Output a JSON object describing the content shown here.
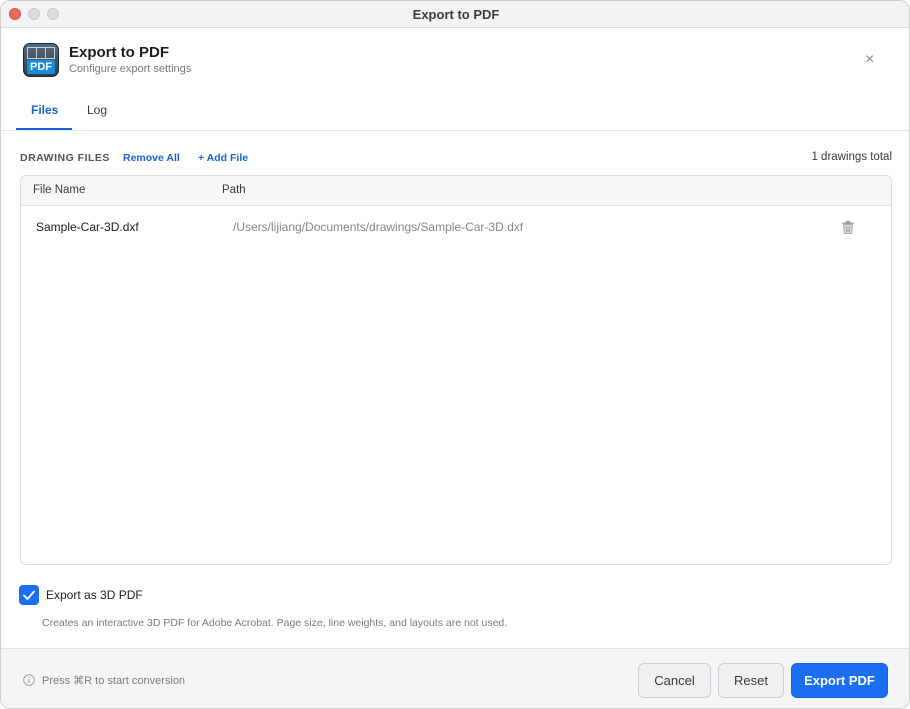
{
  "window": {
    "title": "Export to PDF"
  },
  "header": {
    "icon_label": "PDF",
    "title": "Export to PDF",
    "subtitle": "Configure export settings",
    "close_glyph": "×"
  },
  "tabs": [
    {
      "label": "Files",
      "active": true
    },
    {
      "label": "Log",
      "active": false
    }
  ],
  "files": {
    "section_label": "DRAWING FILES",
    "remove_all_label": "Remove All",
    "add_file_label": "+ Add File",
    "total_text": "1 drawings total",
    "columns": {
      "name": "File Name",
      "path": "Path"
    },
    "rows": [
      {
        "name": "Sample-Car-3D.dxf",
        "path": "/Users/lijiang/Documents/drawings/Sample-Car-3D.dxf"
      }
    ]
  },
  "options": {
    "export_3d_label": "Export as 3D PDF",
    "export_3d_checked": true,
    "export_3d_hint": "Creates an interactive 3D PDF for Adobe Acrobat. Page size, line weights, and layouts are not used."
  },
  "footer": {
    "hint": "Press ⌘R to start conversion",
    "cancel_label": "Cancel",
    "reset_label": "Reset",
    "export_label": "Export PDF"
  },
  "colors": {
    "accent": "#1a6ff2",
    "link": "#1565d8",
    "close_light": "#ed6a5e"
  }
}
